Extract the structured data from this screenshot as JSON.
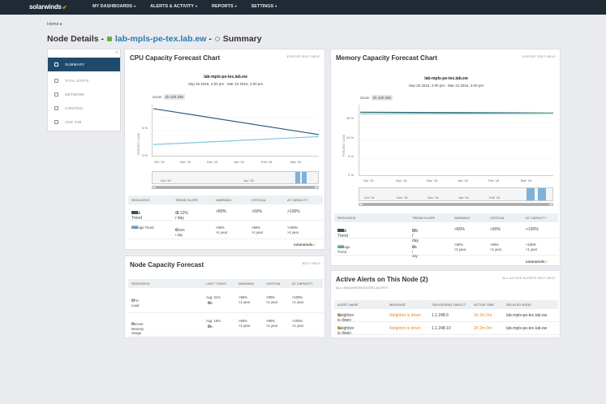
{
  "nav": {
    "logo": "solarwinds",
    "items": [
      "MY DASHBOARDS",
      "ALERTS & ACTIVITY",
      "REPORTS",
      "SETTINGS"
    ]
  },
  "breadcrumb": "Home",
  "page": {
    "prefix": "Node Details -",
    "node": "lab-mpls-pe-tex.lab.ew",
    "sep": "-",
    "view": "Summary"
  },
  "sidebar": {
    "items": [
      "SUMMARY",
      "VITAL STATS",
      "NETWORK",
      "CONFIGS",
      "ADD TAB"
    ]
  },
  "cpu_panel": {
    "title": "CPU Capacity Forecast Chart",
    "tools": "EXPORT  EDIT  HELP",
    "chart_title": "lab-mpls-pe-tex.lab.ew",
    "date_range": "Sep 25 2015, 2:00 pm - Mar 22 2016, 2:00 pm",
    "zoom_label": "Zoom",
    "zoom_btn": "1h  12h  24h",
    "ylabel": "PERCENT LOAD",
    "yticks": [
      "10 %",
      "5 %",
      "0 %"
    ],
    "xticks": [
      "Oct '15",
      "Nov '15",
      "Dec '15",
      "Jan '16",
      "Feb '16",
      "Mar '16"
    ],
    "nav_labels": [
      "Oct '15",
      "Jan '16"
    ],
    "table": {
      "headers": [
        "RESOURCE",
        "TREND SLOPE",
        "WARNING",
        "CRITICAL",
        "AT CAPACITY"
      ],
      "rows": [
        {
          "name": "Peak Trend",
          "slope": "-0.12% / day",
          "warning": ">80%",
          "critical": ">90%",
          "capacity": ">100%"
        },
        {
          "name": "Average Trend",
          "slope": "0.03% / day",
          "warning": ">80%\n>1 year",
          "critical": ">90%\n>1 year",
          "capacity": ">100%\n>1 year"
        }
      ]
    },
    "brand": "solarwinds"
  },
  "mem_panel": {
    "title": "Memory Capacity Forecast Chart",
    "tools": "EXPORT  EDIT  HELP",
    "chart_title": "lab-mpls-pe-tex.lab.ew",
    "date_range": "Sep 25 2015, 2:00 pm - Mar 22 2016, 2:00 pm",
    "zoom_label": "Zoom",
    "zoom_btn": "1h  12h  24h",
    "ylabel": "PERCENT LOAD",
    "yticks": [
      "15 %",
      "10 %",
      "5 %",
      "0 %"
    ],
    "xticks": [
      "Oct '15",
      "Nov '15",
      "Dec '15",
      "Jan '16",
      "Feb '16",
      "Mar '16"
    ],
    "nav_labels": [
      "Oct '15",
      "Nov '15",
      "Dec '15",
      "Jan '16",
      "Feb '16",
      "Mar '16"
    ],
    "table": {
      "headers": [
        "RESOURCE",
        "TREND SLOPE",
        "WARNING",
        "CRITICAL",
        "AT CAPACITY"
      ],
      "rows": [
        {
          "name": "Peak Trend",
          "slope": "0% / day",
          "warning": ">80%",
          "critical": ">90%",
          "capacity": ">100%"
        },
        {
          "name": "Average Trend",
          "slope": "0% / day",
          "warning": ">80%\n>1 year",
          "critical": ">90%\n>1 year",
          "capacity": ">100%\n>1 year"
        }
      ]
    },
    "brand": "solarwinds"
  },
  "node_panel": {
    "title": "Node Capacity Forecast",
    "tools": "EDIT  HELP",
    "headers": [
      "RESOURCE",
      "LAST 7 DAYS",
      "WARNING",
      "CRITICAL",
      "AT CAPACITY"
    ],
    "rows": [
      {
        "name": "CPU Load",
        "avg": "Avg: 21%",
        "trend": "0%",
        "warning": ">90%\n>1 year",
        "critical": ">90%\n>1 year",
        "capacity": ">100%\n>1 year"
      },
      {
        "name": "Percent Memory Usage",
        "avg": "Avg: 15%",
        "trend": "0%",
        "warning": ">90%\n>1 year",
        "critical": ">90%\n>1 year",
        "capacity": ">100%\n>1 year"
      }
    ]
  },
  "alerts_panel": {
    "title": "Active Alerts on This Node (2)",
    "tools": "ALL ACTIVE ALERTS  EDIT  HELP",
    "sub": "ALL UNACKNOWLEDGED ALERTS",
    "headers": [
      "ALERT NAME",
      "MESSAGE",
      "TRIGGERING OBJECT",
      "ACTIVE TIME",
      "RELATED NODE"
    ],
    "rows": [
      {
        "name": "Neighbor is down",
        "message": "Neighbor is down",
        "object": "1.1.248.6",
        "time": "2h 2m 0m",
        "node": "lab-mpls-pe-tex.lab.ew"
      },
      {
        "name": "Neighbor is down",
        "message": "Neighbor is down",
        "object": "1.1.248.10",
        "time": "2h 2m 0m",
        "node": "lab-mpls-pe-tex.lab.ew"
      }
    ]
  },
  "chart_data": [
    {
      "type": "line",
      "title": "lab-mpls-pe-tex.lab.ew",
      "ylabel": "PERCENT LOAD",
      "ylim": [
        0,
        13
      ],
      "x": [
        "Oct '15",
        "Mar '16"
      ],
      "series": [
        {
          "name": "Peak Trend",
          "color": "#2a5d76",
          "values": [
            12,
            5.5
          ]
        },
        {
          "name": "Average Trend",
          "color": "#7fc7dd",
          "values": [
            3.0,
            5.0
          ]
        }
      ]
    },
    {
      "type": "line",
      "title": "lab-mpls-pe-tex.lab.ew",
      "ylabel": "PERCENT LOAD",
      "ylim": [
        0,
        17
      ],
      "x": [
        "Oct '15",
        "Mar '16"
      ],
      "series": [
        {
          "name": "Peak Trend",
          "color": "#2a5d76",
          "values": [
            15.2,
            15.0
          ]
        },
        {
          "name": "Average Trend",
          "color": "#7fd0a8",
          "values": [
            14.8,
            14.9
          ]
        }
      ]
    }
  ]
}
